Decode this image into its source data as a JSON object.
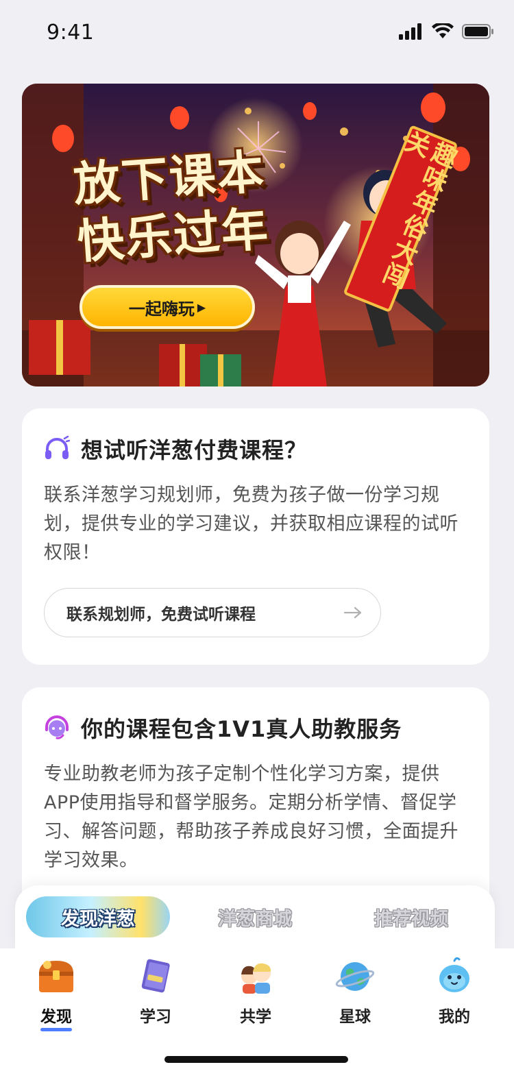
{
  "status_bar": {
    "time": "9:41"
  },
  "banner": {
    "title_line1": "放下课本",
    "title_line2": "快乐过年",
    "cta_label": "一起嗨玩",
    "scroll_text": "趣味年俗大闯关"
  },
  "card_trial": {
    "icon": "headphones-icon",
    "title": "想试听洋葱付费课程？",
    "text": "联系洋葱学习规划师，免费为孩子做一份学习规划，提供专业的学习建议，并获取相应课程的试听权限！",
    "button_label": "联系规划师，免费试听课程"
  },
  "card_service": {
    "icon": "assistant-icon",
    "title": "你的课程包含1V1真人助教服务",
    "text": "专业助教老师为孩子定制个性化学习方案，提供APP使用指导和督学服务。定期分析学情、督促学习、解答问题，帮助孩子养成良好习惯，全面提升学习效果。"
  },
  "subnav": {
    "tabs": [
      {
        "label": "发现洋葱",
        "active": true
      },
      {
        "label": "洋葱商城",
        "active": false
      },
      {
        "label": "推荐视频",
        "active": false
      }
    ]
  },
  "tabbar": {
    "tabs": [
      {
        "label": "发现",
        "icon": "treasure-chest-icon",
        "active": true
      },
      {
        "label": "学习",
        "icon": "study-book-icon",
        "active": false
      },
      {
        "label": "共学",
        "icon": "friends-icon",
        "active": false
      },
      {
        "label": "星球",
        "icon": "planet-icon",
        "active": false
      },
      {
        "label": "我的",
        "icon": "mascot-icon",
        "active": false
      }
    ]
  },
  "colors": {
    "accent": "#4f7dff",
    "icon_purple": "#7b5cf5",
    "cta_yellow": "#ffc400",
    "festival_red": "#d61d1d"
  }
}
